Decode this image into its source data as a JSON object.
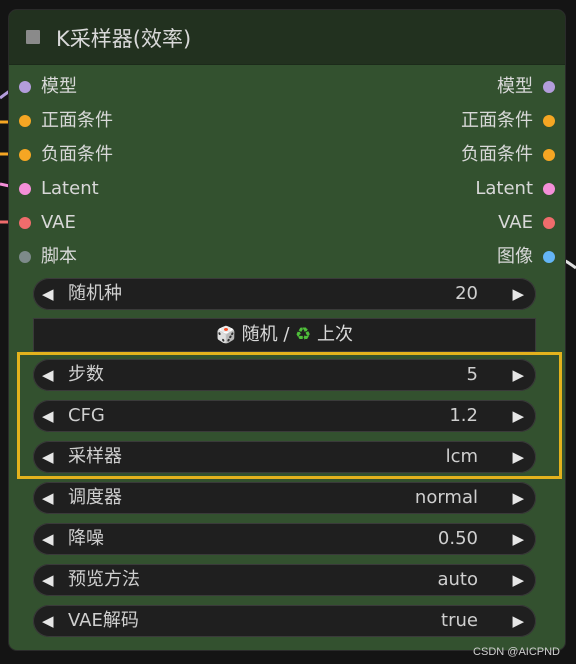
{
  "node": {
    "title": "K采样器(效率)"
  },
  "inputs": [
    {
      "label": "模型",
      "color": "#b39ddb"
    },
    {
      "label": "正面条件",
      "color": "#f5a623"
    },
    {
      "label": "负面条件",
      "color": "#f5a623"
    },
    {
      "label": "Latent",
      "color": "#f48fd8"
    },
    {
      "label": "VAE",
      "color": "#ef6c6c"
    },
    {
      "label": "脚本",
      "color": "#7d8a8a"
    }
  ],
  "outputs": [
    {
      "label": "模型",
      "color": "#b39ddb"
    },
    {
      "label": "正面条件",
      "color": "#f5a623"
    },
    {
      "label": "负面条件",
      "color": "#f5a623"
    },
    {
      "label": "Latent",
      "color": "#f48fd8"
    },
    {
      "label": "VAE",
      "color": "#ef6c6c"
    },
    {
      "label": "图像",
      "color": "#64b5f6"
    }
  ],
  "widgets": [
    {
      "label": "随机种",
      "value": "20"
    },
    {
      "label": "步数",
      "value": "5"
    },
    {
      "label": "CFG",
      "value": "1.2"
    },
    {
      "label": "采样器",
      "value": "lcm"
    },
    {
      "label": "调度器",
      "value": "normal"
    },
    {
      "label": "降噪",
      "value": "0.50"
    },
    {
      "label": "预览方法",
      "value": "auto"
    },
    {
      "label": "VAE解码",
      "value": "true"
    }
  ],
  "seed_button": {
    "dice": "🎲",
    "text1": "随机 /",
    "recycle": "♻",
    "text2": "上次"
  },
  "highlight_color": "#e3b21d",
  "watermark": "CSDN @AICPND"
}
